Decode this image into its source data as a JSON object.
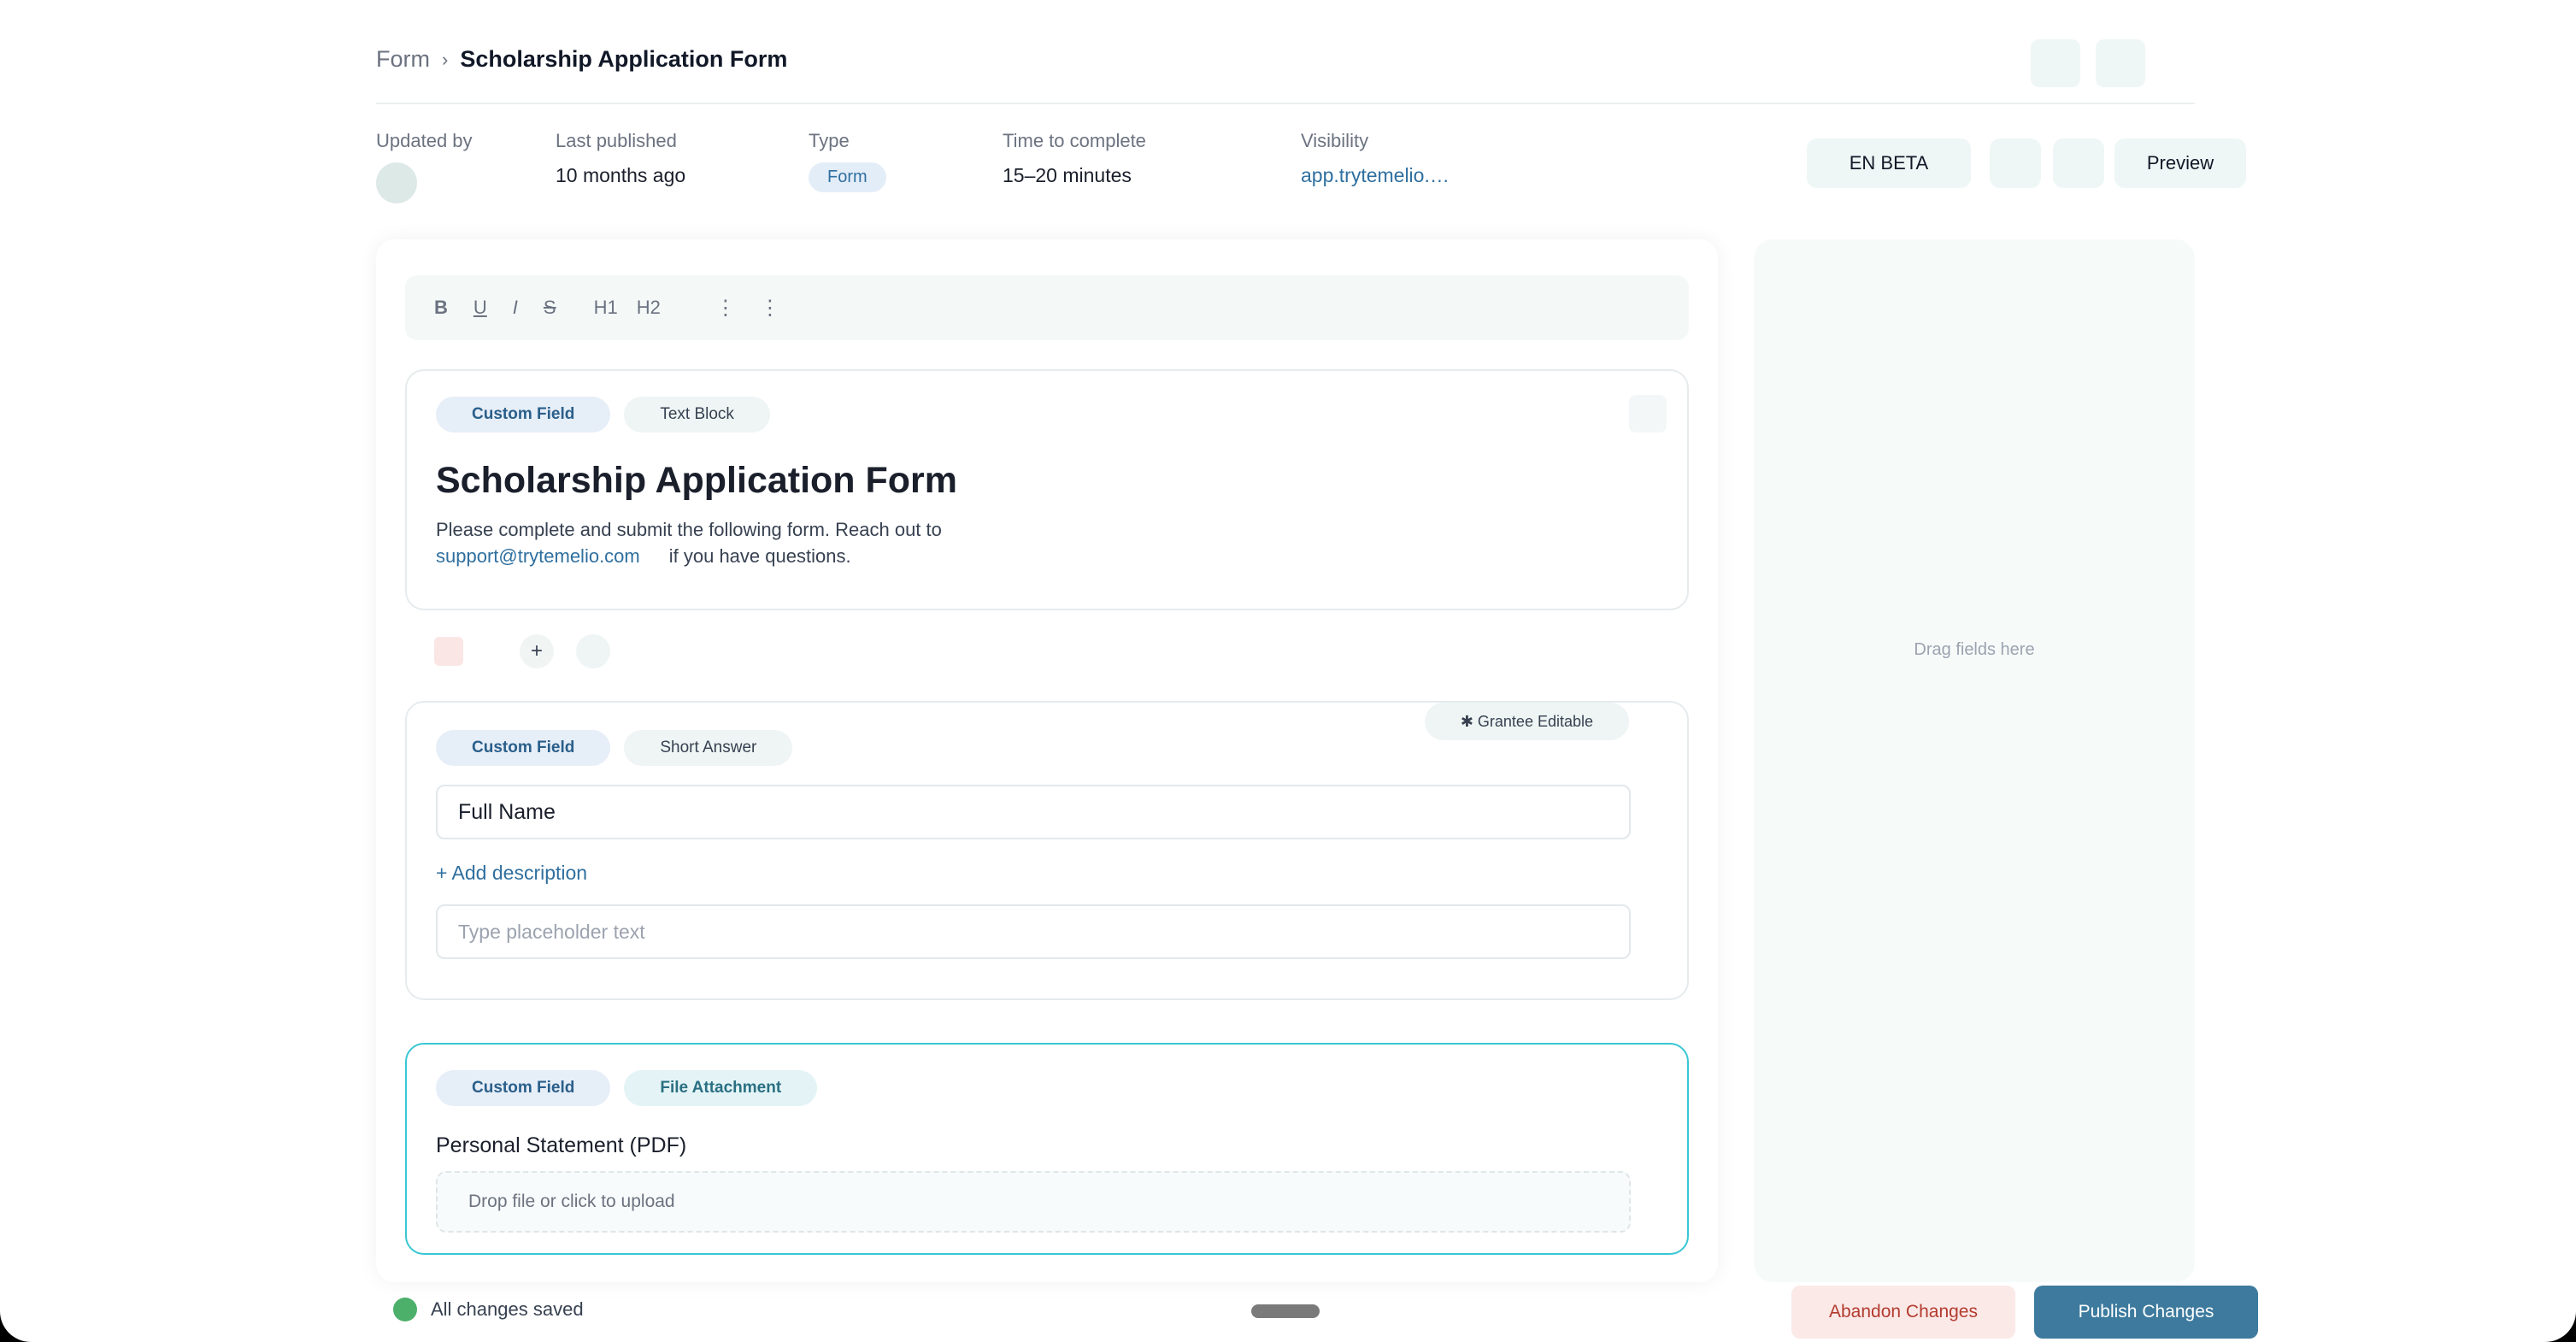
{
  "breadcrumb": {
    "root": "Form",
    "separator": "›",
    "current": "Scholarship Application Form"
  },
  "meta": {
    "updated_by_label": "Updated by",
    "last_published_label": "Last published",
    "last_published_value": "10 months ago",
    "type_label": "Type",
    "type_value": "Form",
    "time_label": "Time to complete",
    "time_value": "15–20 minutes",
    "visibility_label": "Visibility",
    "visibility_value": "app.trytemelio.…"
  },
  "actions": {
    "language": "EN BETA",
    "preview": "Preview"
  },
  "toolbar": {
    "bold": "B",
    "underline": "U",
    "italic": "I",
    "strike": "S",
    "h1": "H1",
    "h2": "H2",
    "more": "⋮⋮"
  },
  "blocks": {
    "text_block": {
      "chip_custom": "Custom Field",
      "chip_type": "Text Block",
      "title": "Scholarship Application Form",
      "desc_line1": "Please complete and submit the following form. Reach out to",
      "email": "support@trytemelio.com",
      "desc_line2": "if you have questions."
    },
    "insert_row": {
      "add": "+"
    },
    "short_answer": {
      "chip_custom": "Custom Field",
      "chip_type": "Short Answer",
      "grantee": "✱ Grantee Editable",
      "field_value": "Full Name",
      "add_description": "+ Add description",
      "placeholder": "Type placeholder text"
    },
    "file_attachment": {
      "chip_custom": "Custom Field",
      "chip_type": "File Attachment",
      "label": "Personal Statement (PDF)",
      "dropzone": "Drop file or click to upload"
    }
  },
  "side_panel": {
    "hint": "Drag fields here"
  },
  "footer": {
    "status": "All changes saved",
    "abandon": "Abandon Changes",
    "publish": "Publish Changes"
  },
  "colors": {
    "accent": "#3d7a9e",
    "active_border": "#38c7d3",
    "success": "#4caf6a",
    "danger_text": "#b33b2e"
  }
}
